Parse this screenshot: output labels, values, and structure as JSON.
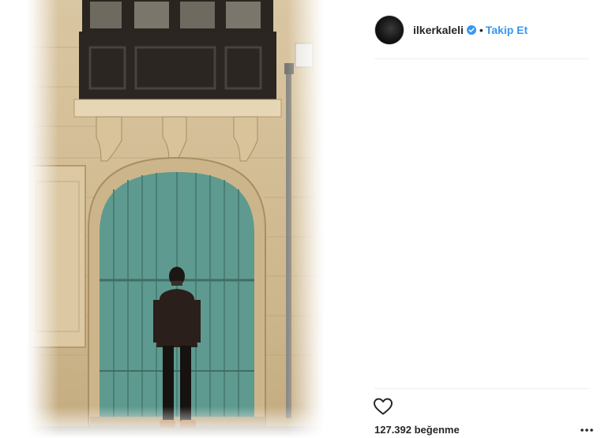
{
  "post": {
    "username": "ilkerkaleli",
    "verified": true,
    "separator": "•",
    "follow_label": "Takip Et",
    "likes_text": "127.392 beğenme"
  },
  "icons": {
    "avatar": "profile-avatar",
    "verified": "verified-badge-icon",
    "like": "heart-icon",
    "more": "more-options-icon"
  },
  "colors": {
    "link_blue": "#3897f0",
    "text": "#262626",
    "door_teal": "#5e9a8f",
    "divider": "#efefef"
  }
}
